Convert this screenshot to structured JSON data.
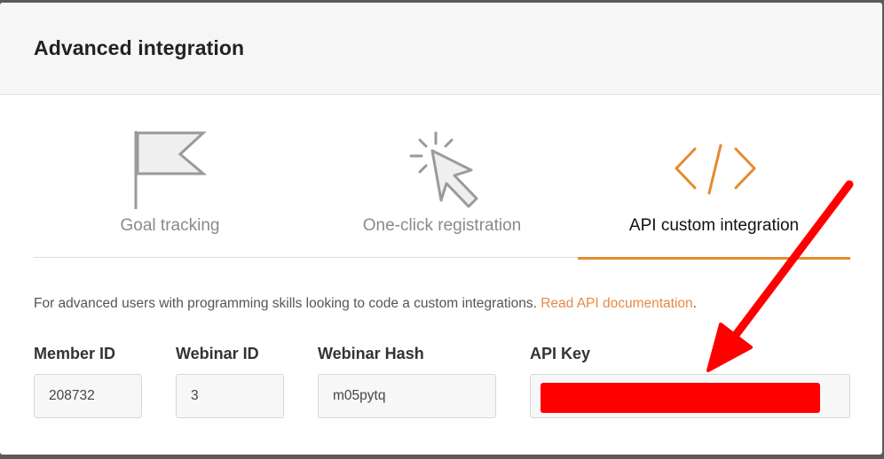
{
  "modal": {
    "title": "Advanced integration"
  },
  "tabs": [
    {
      "label": "Goal tracking",
      "icon": "flag-icon",
      "active": false
    },
    {
      "label": "One-click registration",
      "icon": "cursor-click-icon",
      "active": false
    },
    {
      "label": "API custom integration",
      "icon": "code-icon",
      "active": true
    }
  ],
  "description": {
    "text": "For advanced users with programming skills looking to code a custom integrations. ",
    "link": "Read API documentation",
    "suffix": "."
  },
  "fields": {
    "member_id": {
      "label": "Member ID",
      "value": "208732"
    },
    "webinar_id": {
      "label": "Webinar ID",
      "value": "3"
    },
    "webinar_hash": {
      "label": "Webinar Hash",
      "value": "m05pytq"
    },
    "api_key": {
      "label": "API Key",
      "value": ""
    }
  },
  "colors": {
    "accent": "#e58a2e",
    "link": "#e58a47",
    "annotation": "#ff0000"
  }
}
